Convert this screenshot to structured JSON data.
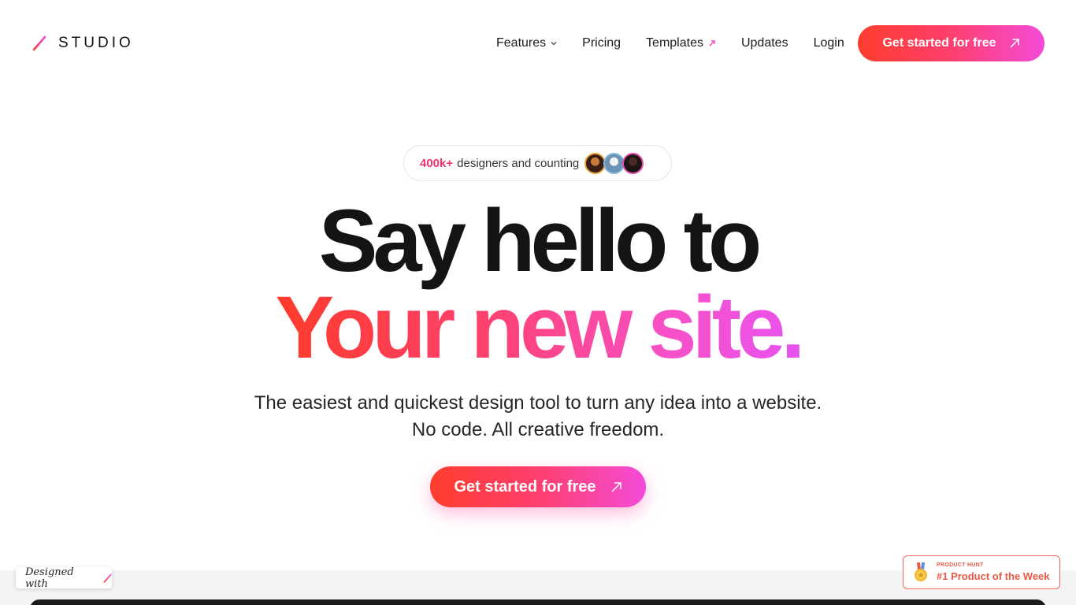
{
  "brand": {
    "name": "STUDIO",
    "accent": "#f0336b"
  },
  "nav": {
    "items": [
      {
        "label": "Features",
        "icon": "chevron-down-icon"
      },
      {
        "label": "Pricing"
      },
      {
        "label": "Templates",
        "icon": "external-arrow-icon"
      },
      {
        "label": "Updates"
      },
      {
        "label": "Login"
      }
    ],
    "cta_label": "Get started for free"
  },
  "badge": {
    "count": "400k+",
    "text": "designers and counting"
  },
  "hero": {
    "line1": "Say hello to",
    "line2": "Your new site.",
    "subtitle_line1": "The easiest and quickest design tool to turn any idea into a website.",
    "subtitle_line2": "No code. All creative freedom.",
    "cta_label": "Get started for free"
  },
  "footer": {
    "designed_with": "Designed with",
    "product_hunt_small": "PRODUCT HUNT",
    "product_hunt_big": "#1 Product of the Week"
  },
  "colors": {
    "gradient_start": "#ff3d2e",
    "gradient_mid": "#ff3f6e",
    "gradient_end": "#f44bd8",
    "heading": "#141414"
  }
}
